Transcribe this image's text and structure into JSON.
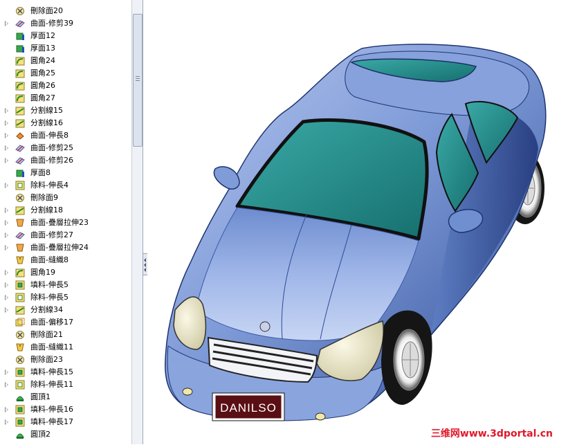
{
  "feature_tree": {
    "items": [
      {
        "label": "刪除面20",
        "icon": "delete-face-icon",
        "expandable": false
      },
      {
        "label": "曲面-修剪39",
        "icon": "surface-trim-icon",
        "expandable": true
      },
      {
        "label": "厚面12",
        "icon": "thicken-icon",
        "expandable": false
      },
      {
        "label": "厚面13",
        "icon": "thicken-icon",
        "expandable": false
      },
      {
        "label": "圓角24",
        "icon": "fillet-icon",
        "expandable": false
      },
      {
        "label": "圓角25",
        "icon": "fillet-icon",
        "expandable": false
      },
      {
        "label": "圓角26",
        "icon": "fillet-icon",
        "expandable": false
      },
      {
        "label": "圓角27",
        "icon": "fillet-icon",
        "expandable": false
      },
      {
        "label": "分割線15",
        "icon": "split-line-icon",
        "expandable": true
      },
      {
        "label": "分割線16",
        "icon": "split-line-icon",
        "expandable": true
      },
      {
        "label": "曲面-伸長8",
        "icon": "surface-extrude-icon",
        "expandable": true
      },
      {
        "label": "曲面-修剪25",
        "icon": "surface-trim-icon",
        "expandable": true
      },
      {
        "label": "曲面-修剪26",
        "icon": "surface-trim-icon",
        "expandable": true
      },
      {
        "label": "厚面8",
        "icon": "thicken-icon",
        "expandable": false
      },
      {
        "label": "除料-伸長4",
        "icon": "cut-extrude-icon",
        "expandable": true
      },
      {
        "label": "刪除面9",
        "icon": "delete-face-icon",
        "expandable": false
      },
      {
        "label": "分割線18",
        "icon": "split-line-icon",
        "expandable": true
      },
      {
        "label": "曲面-疊層拉伸23",
        "icon": "surface-loft-icon",
        "expandable": true
      },
      {
        "label": "曲面-修剪27",
        "icon": "surface-trim-icon",
        "expandable": true
      },
      {
        "label": "曲面-疊層拉伸24",
        "icon": "surface-loft-icon",
        "expandable": true
      },
      {
        "label": "曲面-縫織8",
        "icon": "surface-knit-icon",
        "expandable": false
      },
      {
        "label": "圓角19",
        "icon": "fillet-icon",
        "expandable": true
      },
      {
        "label": "填料-伸長5",
        "icon": "boss-extrude-icon",
        "expandable": true
      },
      {
        "label": "除料-伸長5",
        "icon": "cut-extrude-icon",
        "expandable": true
      },
      {
        "label": "分割線34",
        "icon": "split-line-icon",
        "expandable": true
      },
      {
        "label": "曲面-偏移17",
        "icon": "surface-offset-icon",
        "expandable": false
      },
      {
        "label": "刪除面21",
        "icon": "delete-face-icon",
        "expandable": false
      },
      {
        "label": "曲面-縫織11",
        "icon": "surface-knit-icon",
        "expandable": false
      },
      {
        "label": "刪除面23",
        "icon": "delete-face-icon",
        "expandable": false
      },
      {
        "label": "填料-伸長15",
        "icon": "boss-extrude-icon",
        "expandable": true
      },
      {
        "label": "除料-伸長11",
        "icon": "cut-extrude-icon",
        "expandable": true
      },
      {
        "label": "圓頂1",
        "icon": "dome-icon",
        "expandable": false
      },
      {
        "label": "填料-伸長16",
        "icon": "boss-extrude-icon",
        "expandable": true
      },
      {
        "label": "填料-伸長17",
        "icon": "boss-extrude-icon",
        "expandable": true
      },
      {
        "label": "圓頂2",
        "icon": "dome-icon",
        "expandable": false
      }
    ]
  },
  "viewport": {
    "model": "car-3d-model",
    "license_plate": "DANILSO",
    "body_color": "#6f8fd0",
    "glass_color": "#2e9a9a"
  },
  "watermark": {
    "text": "三维网www.3dportal.cn",
    "color": "#e0182a"
  }
}
